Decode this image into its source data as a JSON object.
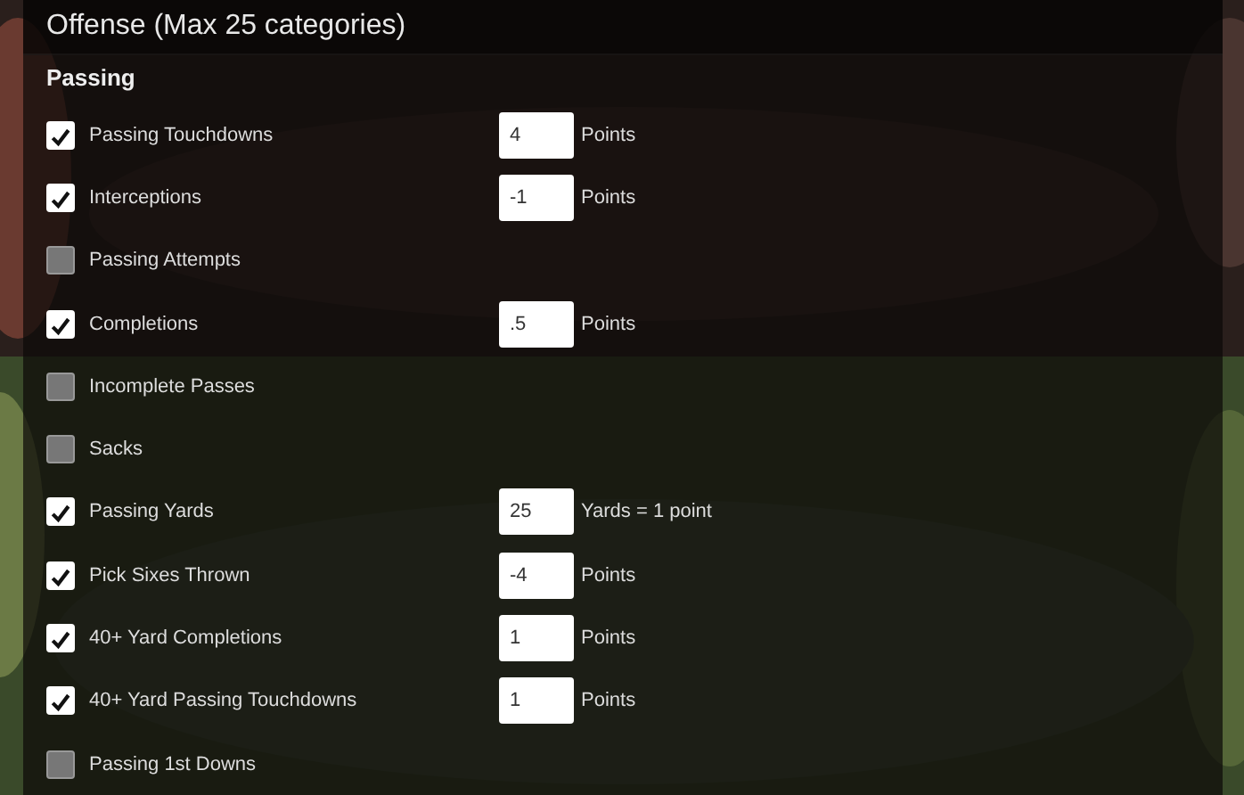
{
  "heading": "Offense (Max 25 categories)",
  "section": "Passing",
  "rows": [
    {
      "label": "Passing Touchdowns",
      "checked": true,
      "value": "4",
      "unit": "Points"
    },
    {
      "label": "Interceptions",
      "checked": true,
      "value": "-1",
      "unit": "Points"
    },
    {
      "label": "Passing Attempts",
      "checked": false
    },
    {
      "label": "Completions",
      "checked": true,
      "value": ".5",
      "unit": "Points"
    },
    {
      "label": "Incomplete Passes",
      "checked": false
    },
    {
      "label": "Sacks",
      "checked": false
    },
    {
      "label": "Passing Yards",
      "checked": true,
      "value": "25",
      "unit": "Yards = 1 point"
    },
    {
      "label": "Pick Sixes Thrown",
      "checked": true,
      "value": "-4",
      "unit": "Points"
    },
    {
      "label": "40+ Yard Completions",
      "checked": true,
      "value": "1",
      "unit": "Points"
    },
    {
      "label": "40+ Yard Passing Touchdowns",
      "checked": true,
      "value": "1",
      "unit": "Points"
    },
    {
      "label": "Passing 1st Downs",
      "checked": false
    }
  ]
}
